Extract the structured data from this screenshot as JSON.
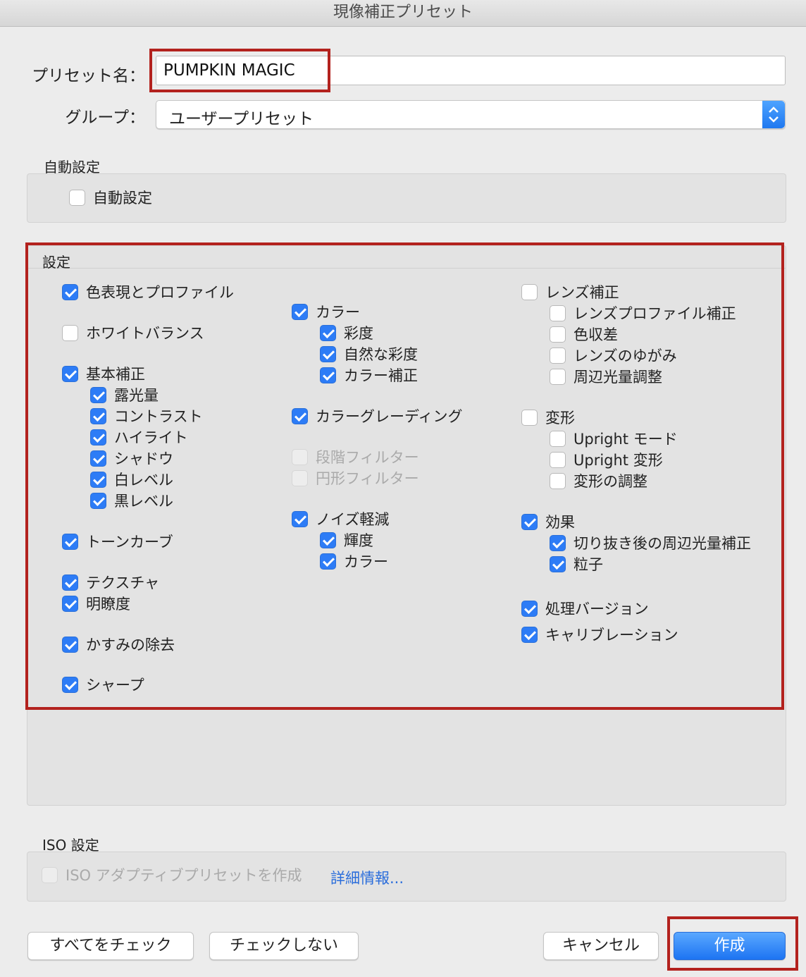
{
  "window": {
    "title": "現像補正プリセット"
  },
  "form": {
    "preset_name_label": "プリセット名：",
    "preset_name_value": "PUMPKIN MAGIC",
    "group_label": "グループ：",
    "group_value": "ユーザープリセット"
  },
  "auto_section": {
    "title": "自動設定",
    "checkbox": {
      "label": "自動設定",
      "checked": false
    }
  },
  "settings": {
    "title": "設定",
    "col1": [
      {
        "label": "色表現とプロファイル",
        "checked": true
      },
      {
        "label": "ホワイトバランス",
        "checked": false
      },
      {
        "label": "基本補正",
        "checked": true
      },
      {
        "label": "露光量",
        "checked": true
      },
      {
        "label": "コントラスト",
        "checked": true
      },
      {
        "label": "ハイライト",
        "checked": true
      },
      {
        "label": "シャドウ",
        "checked": true
      },
      {
        "label": "白レベル",
        "checked": true
      },
      {
        "label": "黒レベル",
        "checked": true
      },
      {
        "label": "トーンカーブ",
        "checked": true
      },
      {
        "label": "テクスチャ",
        "checked": true
      },
      {
        "label": "明瞭度",
        "checked": true
      },
      {
        "label": "かすみの除去",
        "checked": true
      },
      {
        "label": "シャープ",
        "checked": true
      }
    ],
    "col2": [
      {
        "label": "カラー",
        "checked": true
      },
      {
        "label": "彩度",
        "checked": true
      },
      {
        "label": "自然な彩度",
        "checked": true
      },
      {
        "label": "カラー補正",
        "checked": true
      },
      {
        "label": "カラーグレーディング",
        "checked": true
      },
      {
        "label": "段階フィルター",
        "checked": false,
        "disabled": true
      },
      {
        "label": "円形フィルター",
        "checked": false,
        "disabled": true
      },
      {
        "label": "ノイズ軽減",
        "checked": true
      },
      {
        "label": "輝度",
        "checked": true
      },
      {
        "label": "カラー",
        "checked": true
      }
    ],
    "col3": [
      {
        "label": "レンズ補正",
        "checked": false
      },
      {
        "label": "レンズプロファイル補正",
        "checked": false
      },
      {
        "label": "色収差",
        "checked": false
      },
      {
        "label": "レンズのゆがみ",
        "checked": false
      },
      {
        "label": "周辺光量調整",
        "checked": false
      },
      {
        "label": "変形",
        "checked": false
      },
      {
        "label": "Upright モード",
        "checked": false
      },
      {
        "label": "Upright 変形",
        "checked": false
      },
      {
        "label": "変形の調整",
        "checked": false
      },
      {
        "label": "効果",
        "checked": true
      },
      {
        "label": "切り抜き後の周辺光量補正",
        "checked": true
      },
      {
        "label": "粒子",
        "checked": true
      },
      {
        "label": "処理バージョン",
        "checked": true
      },
      {
        "label": "キャリブレーション",
        "checked": true
      }
    ]
  },
  "iso_section": {
    "title": "ISO 設定",
    "checkbox": {
      "label": "ISO アダプティブプリセットを作成",
      "checked": false,
      "disabled": true
    },
    "link": "詳細情報..."
  },
  "buttons": {
    "check_all": "すべてをチェック",
    "check_none": "チェックしない",
    "cancel": "キャンセル",
    "create": "作成"
  },
  "colors": {
    "accent": "#2d7cf6",
    "highlight_frame": "#b3221e"
  }
}
